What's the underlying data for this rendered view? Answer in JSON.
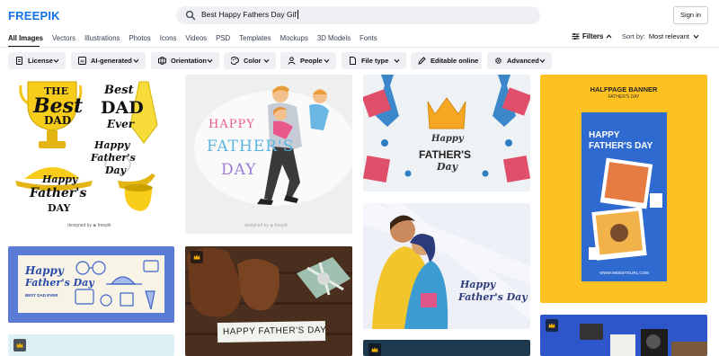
{
  "header": {
    "logo": "FREEPIK",
    "search_value": "Best Happy Fathers Day Gif",
    "signin_label": "Sign in"
  },
  "tabs": [
    {
      "label": "All Images",
      "active": true
    },
    {
      "label": "Vectors"
    },
    {
      "label": "Illustrations"
    },
    {
      "label": "Photos"
    },
    {
      "label": "Icons"
    },
    {
      "label": "Videos"
    },
    {
      "label": "PSD"
    },
    {
      "label": "Templates"
    },
    {
      "label": "Mockups"
    },
    {
      "label": "3D Models"
    },
    {
      "label": "Fonts"
    }
  ],
  "toolbar": {
    "filters_label": "Filters",
    "sort_prefix": "Sort by:",
    "sort_value": "Most relevant"
  },
  "chips": [
    {
      "label": "License",
      "icon": "document-icon"
    },
    {
      "label": "AI-generated",
      "icon": "ai-icon"
    },
    {
      "label": "Orientation",
      "icon": "orientation-icon"
    },
    {
      "label": "Color",
      "icon": "palette-icon"
    },
    {
      "label": "People",
      "icon": "people-icon"
    },
    {
      "label": "File type",
      "icon": "file-icon"
    },
    {
      "label": "Editable online",
      "icon": "pencil-icon"
    },
    {
      "label": "Advanced",
      "icon": "gear-icon"
    }
  ],
  "cards": {
    "c1": {
      "l1": "THE",
      "l2": "Best",
      "l3": "DAD",
      "r1": "Best",
      "r2": "DAD",
      "r3": "Ever",
      "m1": "Happy",
      "m2": "Father's",
      "m3": "Day",
      "b1": "Happy",
      "b2": "Father's",
      "b3": "DAY",
      "credit": "designed by ◈ freepik"
    },
    "c2": {
      "t1": "HAPPY",
      "t2": "FATHER'S",
      "t3": "DAY",
      "credit": "designed by ◈ freepik"
    },
    "c3": {
      "t1": "Happy",
      "t2": "FATHER'S",
      "t3": "Day"
    },
    "c4": {
      "t1": "HALFPAGE BANNER",
      "t2": "FATHER'S DAY",
      "t3": "HAPPY",
      "t4": "FATHER'S DAY",
      "url": "WWW.WEBSITEURL.COM"
    },
    "c5": {
      "t1": "Happy",
      "t2": "Father's Day",
      "t3": "BEST DAD EVER"
    },
    "c6": {
      "t1": "HAPPY FATHER'S DAY"
    },
    "c7": {
      "t1": "Happy",
      "t2": "Father's Day"
    }
  },
  "colors": {
    "brand": "#1273eb",
    "premium_badge": "#f2b000",
    "banner_yellow": "#fdc221"
  }
}
